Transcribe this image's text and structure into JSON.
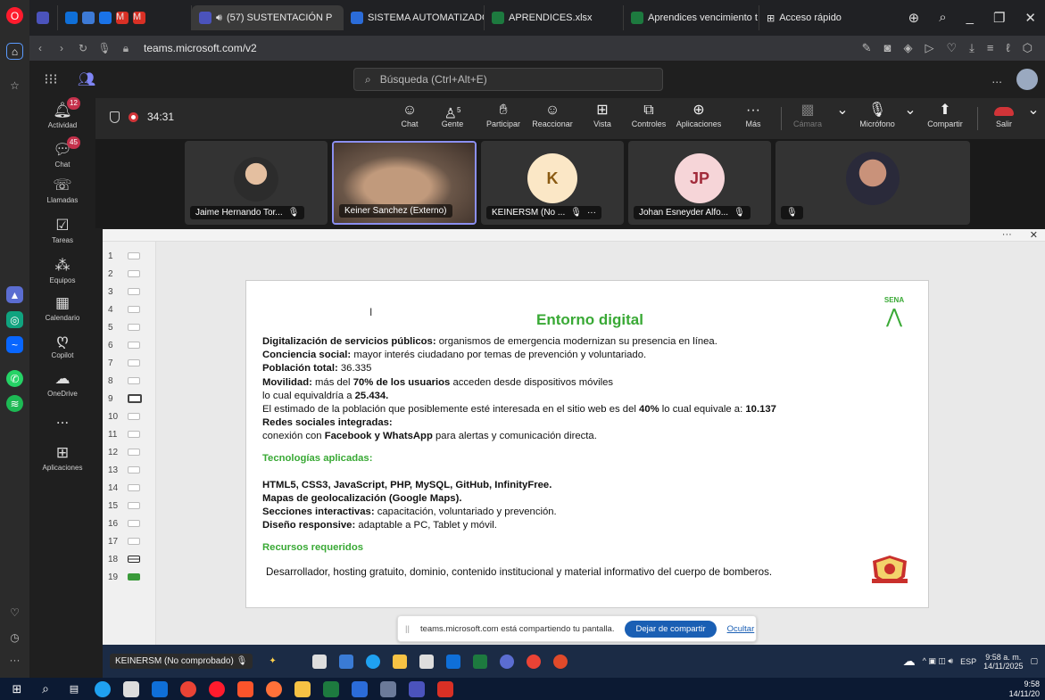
{
  "browser": {
    "tabs": [
      {
        "label": "(57) SUSTENTACIÓN P",
        "color": "#4b53bc",
        "active": true
      },
      {
        "label": "SISTEMA AUTOMATIZADO",
        "color": "#2b6cd9",
        "active": false
      },
      {
        "label": "APRENDICES.xlsx",
        "color": "#1d7a3f",
        "active": false
      },
      {
        "label": "Aprendices vencimiento t",
        "color": "#1d7a3f",
        "active": false
      },
      {
        "label": "Acceso rápido",
        "color": "#555555",
        "active": false
      }
    ],
    "url": "teams.microsoft.com/v2"
  },
  "teams": {
    "search_placeholder": "Búsqueda (Ctrl+Alt+E)",
    "more": "...",
    "apps": [
      {
        "label": "Actividad",
        "icon": "bell",
        "badge": "12"
      },
      {
        "label": "Chat",
        "icon": "chat",
        "badge": "45"
      },
      {
        "label": "Llamadas",
        "icon": "phone",
        "badge": ""
      },
      {
        "label": "Tareas",
        "icon": "tasks",
        "badge": ""
      },
      {
        "label": "Equipos",
        "icon": "teams",
        "badge": ""
      },
      {
        "label": "Calendario",
        "icon": "calendar",
        "badge": ""
      },
      {
        "label": "Copilot",
        "icon": "copilot",
        "badge": ""
      },
      {
        "label": "OneDrive",
        "icon": "cloud",
        "badge": ""
      },
      {
        "label": "...",
        "icon": "more",
        "badge": ""
      },
      {
        "label": "Aplicaciones",
        "icon": "plus",
        "badge": ""
      }
    ]
  },
  "meeting": {
    "timer": "34:31",
    "toolbar": {
      "chat": "Chat",
      "people": "Gente",
      "people_count": "5",
      "raise": "Participar",
      "react": "Reaccionar",
      "view": "Vista",
      "controls": "Controles",
      "apps": "Aplicaciones",
      "more": "Más",
      "camera": "Cámara",
      "mic": "Micrófono",
      "share": "Compartir",
      "leave": "Salir"
    },
    "participants": [
      {
        "name": "Jaime Hernando Tor...",
        "type": "photo",
        "active": false
      },
      {
        "name": "Keiner Sanchez (Externo)",
        "type": "video",
        "active": true
      },
      {
        "name": "KEINERSM (No ...",
        "type": "initial",
        "initial": "K",
        "bg": "#fbe7c6",
        "fg": "#8a5a12",
        "active": false
      },
      {
        "name": "Johan Esneyder Alfo...",
        "type": "initial",
        "initial": "JP",
        "bg": "#f6d5d8",
        "fg": "#a12a3a",
        "active": false
      },
      {
        "name": "",
        "type": "photo2",
        "active": false
      }
    ]
  },
  "presentation": {
    "slide_numbers": [
      "1",
      "2",
      "3",
      "4",
      "5",
      "6",
      "7",
      "8",
      "9",
      "10",
      "11",
      "12",
      "13",
      "14",
      "15",
      "16",
      "17",
      "18",
      "19"
    ],
    "selected_slide": "9",
    "title": "Entorno digital",
    "sena_label": "SENA",
    "lines": [
      {
        "bold": "Digitalización de servicios públicos:",
        "text": " organismos de emergencia modernizan su presencia en línea."
      },
      {
        "bold": "Conciencia social:",
        "text": " mayor interés ciudadano por temas de prevención y voluntariado."
      },
      {
        "bold": "Población total:",
        "text": " 36.335"
      },
      {
        "bold": "Movilidad:",
        "text": " más del ",
        "bold2": "70% de los usuarios",
        "text2": " acceden desde dispositivos móviles"
      },
      {
        "bold": "",
        "text": "lo cual equivaldría a ",
        "bold2": "25.434.",
        "text2": ""
      },
      {
        "bold": "",
        "text": "El estimado de la población que posiblemente esté interesada en el sitio web es del ",
        "bold2": "40%",
        "text2": " lo cual equivale a: ",
        "bold3": "10.137"
      },
      {
        "bold": "Redes sociales integradas:",
        "text": ""
      },
      {
        "bold": "",
        "text": "conexión con ",
        "bold2": "Facebook y WhatsApp",
        "text2": " para alertas y comunicación directa."
      }
    ],
    "tech_heading": "Tecnologías aplicadas:",
    "tech_lines": [
      {
        "bold": "HTML5, CSS3, JavaScript, PHP, MySQL, GitHub, InfinityFree.",
        "text": ""
      },
      {
        "bold": "Mapas de geolocalización (Google Maps).",
        "text": ""
      },
      {
        "bold": "Secciones interactivas:",
        "text": " capacitación, voluntariado y prevención."
      },
      {
        "bold": "Diseño responsive:",
        "text": " adaptable a PC, Tablet y móvil."
      }
    ],
    "resources_heading": "Recursos requeridos",
    "resources_text": "Desarrollador, hosting gratuito, dominio, contenido institucional y material informativo del cuerpo de bomberos."
  },
  "share_notice": {
    "text": "teams.microsoft.com está compartiendo tu pantalla.",
    "stop": "Dejar de compartir",
    "hide": "Ocultar"
  },
  "inner_taskbar": {
    "presenter": "KEINERSM (No comprobado)",
    "lang": "ESP",
    "time": "9:58 a. m.",
    "date": "14/11/2025"
  },
  "taskbar": {
    "time": "9:58",
    "date": "14/11/20"
  }
}
